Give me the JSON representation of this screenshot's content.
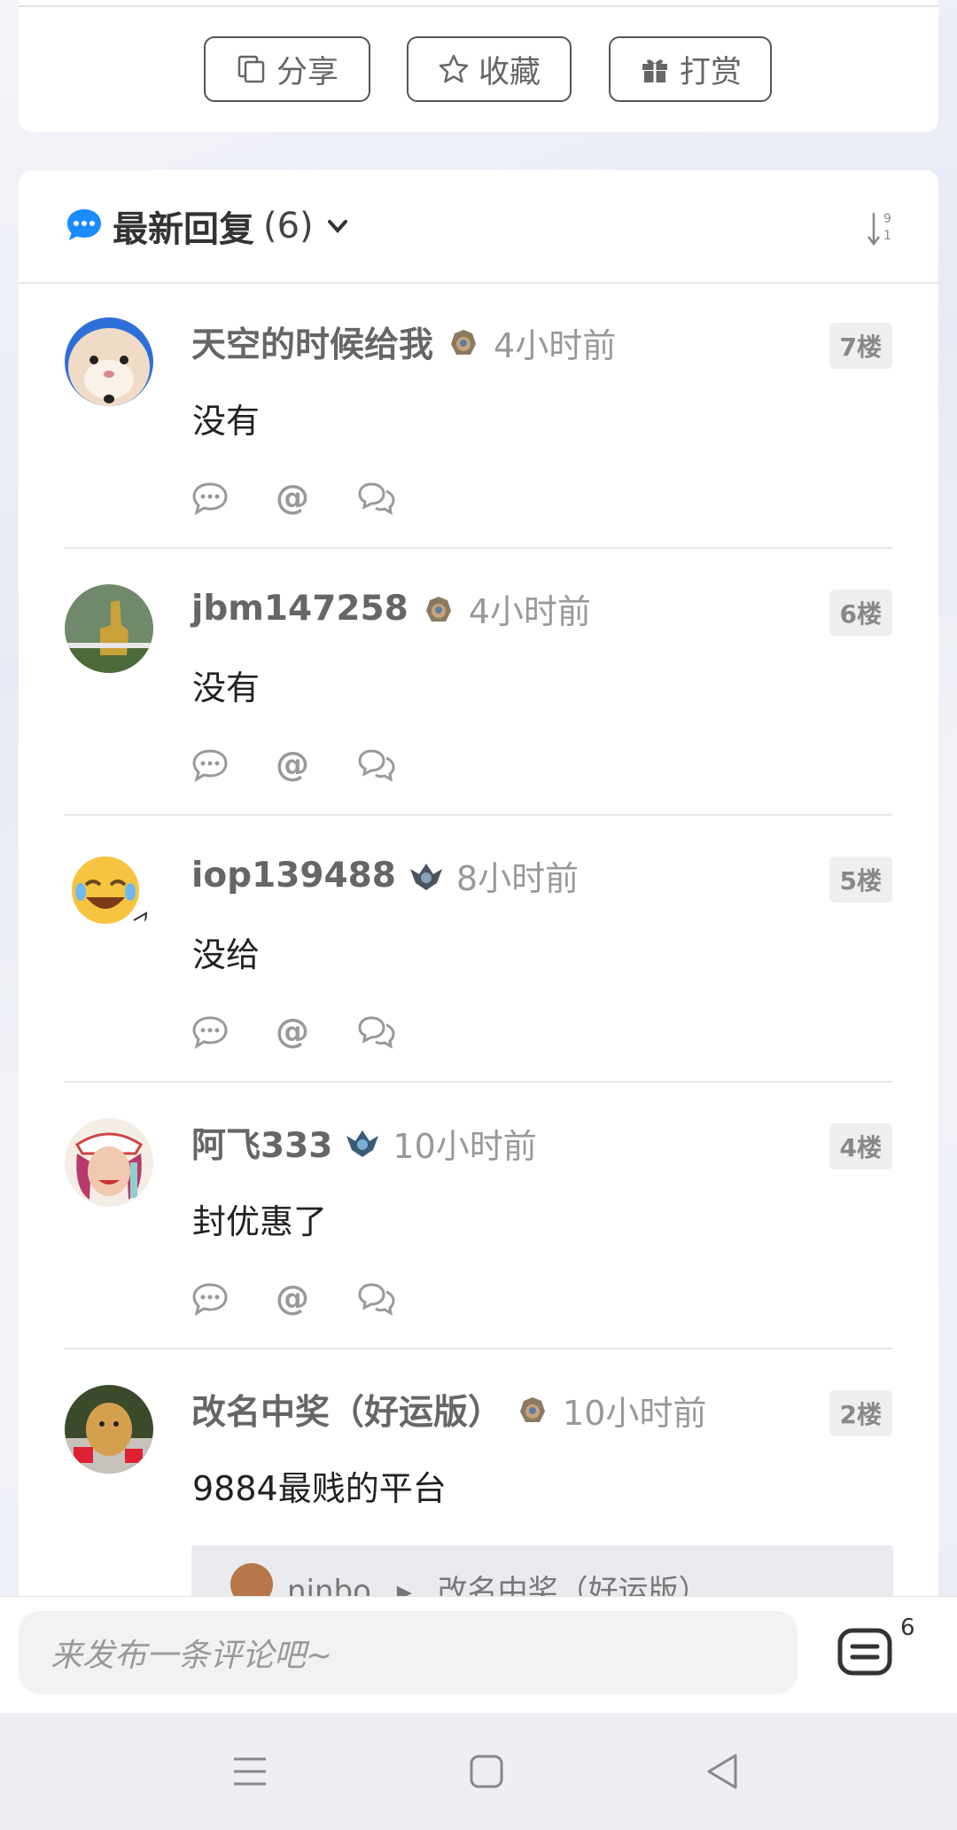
{
  "actions": [
    {
      "label": "分享",
      "icon": "share-icon"
    },
    {
      "label": "收藏",
      "icon": "star-icon"
    },
    {
      "label": "打赏",
      "icon": "gift-icon"
    }
  ],
  "comments_header": {
    "title": "最新回复",
    "count": "(6)",
    "accent_color": "#1a8cff"
  },
  "comments": [
    {
      "user": "天空的时候给我",
      "time": "4小时前",
      "floor": "7楼",
      "text": "没有",
      "badge": "helmet-badge"
    },
    {
      "user": "jbm147258",
      "time": "4小时前",
      "floor": "6楼",
      "text": "没有",
      "badge": "helmet-badge"
    },
    {
      "user": "iop139488",
      "time": "8小时前",
      "floor": "5楼",
      "text": "没给",
      "badge": "emblem-badge"
    },
    {
      "user": "阿飞333",
      "time": "10小时前",
      "floor": "4楼",
      "text": "封优惠了",
      "badge": "emblem-badge"
    },
    {
      "user": "改名中奖（好运版）",
      "time": "10小时前",
      "floor": "2楼",
      "text": "9884最贱的平台",
      "badge": "helmet-badge"
    }
  ],
  "quote": {
    "from": "ninbo",
    "arrow": "▸",
    "to": "改名中奖（好运版）"
  },
  "bottom": {
    "placeholder": "来发布一条评论吧~",
    "comment_count": "6"
  }
}
